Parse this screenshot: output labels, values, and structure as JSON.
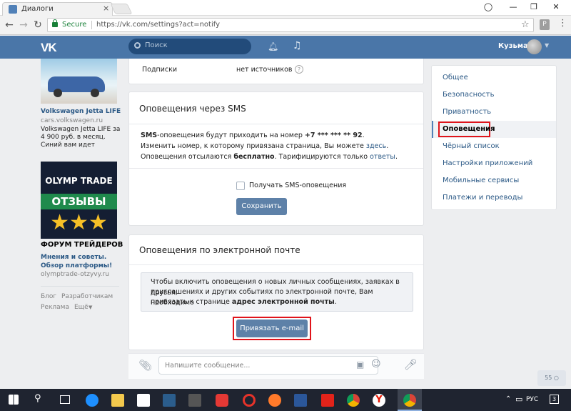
{
  "browser": {
    "tab_title": "Диалоги",
    "tab_close": "×",
    "secure_label": "Secure",
    "url": "https://vk.com/settings?act=notify",
    "profile_badge": "P"
  },
  "vk_header": {
    "logo": "VK",
    "search_placeholder": "Поиск",
    "username": "Кузьма"
  },
  "ads": [
    {
      "title": "Volkswagen Jetta LIFE",
      "domain": "cars.volkswagen.ru",
      "text": "Volkswagen Jetta LIFE за 4 900 руб. в месяц. Синий вам идет"
    },
    {
      "image_line1": "OLYMP TRADE",
      "image_line2": "ОТЗЫВЫ",
      "title": "ФОРУМ ТРЕЙДЕРОВ",
      "text": "Мнения и советы. Обзор платформы!",
      "domain": "olymptrade-otzyvy.ru"
    }
  ],
  "footer_links": [
    "Блог",
    "Разработчикам",
    "Реклама",
    "Ещё"
  ],
  "subscriptions": {
    "label": "Подписки",
    "value": "нет источников",
    "help": "?"
  },
  "sms": {
    "title": "Оповещения через SMS",
    "line1_bold": "SMS",
    "line1_text": "-оповещения будут приходить на номер ",
    "phone": "+7 *** *** ** 92",
    "line2_text": "Изменить номер, к которому привязана страница, Вы можете ",
    "line2_link": "здесь",
    "line3_text": "Оповещения отсылаются ",
    "line3_bold": "бесплатно",
    "line3_text2": ". Тарифицируются только ",
    "line3_link": "ответы",
    "checkbox_label": "Получать SMS-оповещения",
    "save_button": "Сохранить"
  },
  "email": {
    "title": "Оповещения по электронной почте",
    "notice_line1": "Чтобы включить оповещения о новых личных сообщениях, заявках в друзья,",
    "notice_line2": "приглашениях и других событиях по электронной почте, Вам необходимо",
    "notice_line3": "привязать к странице ",
    "notice_bold": "адрес электронной почты",
    "bind_button": "Привязать e-mail"
  },
  "message_bar": {
    "placeholder": "Напишите сообщение..."
  },
  "settings_menu": [
    {
      "label": "Общее",
      "active": false
    },
    {
      "label": "Безопасность",
      "active": false
    },
    {
      "label": "Приватность",
      "active": false
    },
    {
      "label": "Оповещения",
      "active": true
    },
    {
      "label": "Чёрный список",
      "active": false
    },
    {
      "label": "Настройки приложений",
      "active": false
    },
    {
      "label": "Мобильные сервисы",
      "active": false
    },
    {
      "label": "Платежи и переводы",
      "active": false
    }
  ],
  "chat_chip": "55",
  "taskbar": {
    "language": "РУС",
    "notifications": "3"
  },
  "colors": {
    "vk_blue": "#4a76a8",
    "button": "#5e81a8",
    "highlight": "#e0141b"
  }
}
